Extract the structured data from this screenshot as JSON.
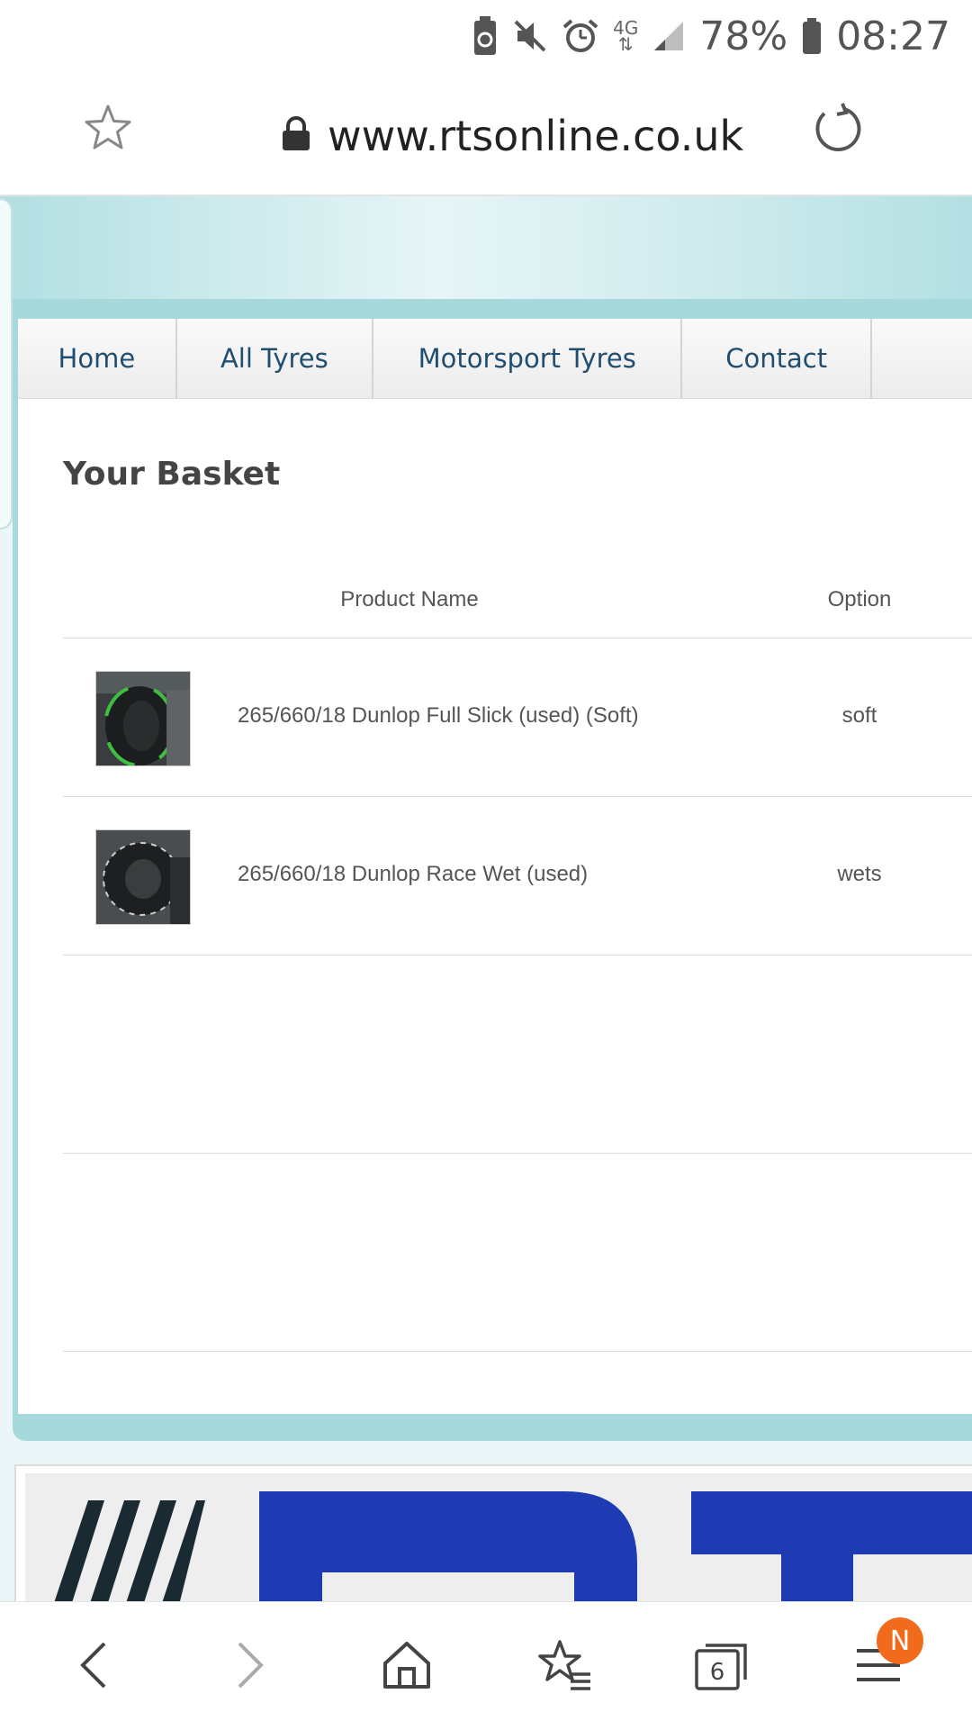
{
  "status_bar": {
    "network": "4G",
    "battery_percent": "78%",
    "time": "08:27",
    "icons": [
      "battery-saver-icon",
      "mute-icon",
      "alarm-icon",
      "network-4g-icon",
      "signal-icon",
      "battery-icon"
    ]
  },
  "address_bar": {
    "url": "www.rtsonline.co.uk",
    "icons": [
      "bookmark-star-icon",
      "lock-icon",
      "reload-icon"
    ]
  },
  "nav": {
    "items": [
      {
        "label": "Home"
      },
      {
        "label": "All Tyres"
      },
      {
        "label": "Motorsport Tyres"
      },
      {
        "label": "Contact"
      },
      {
        "label": ""
      }
    ]
  },
  "basket": {
    "title": "Your Basket",
    "columns": [
      "Product Name",
      "Option"
    ],
    "rows": [
      {
        "name": "265/660/18 Dunlop Full Slick (used) (Soft)",
        "option": "soft",
        "thumb": "slick-tyre-image"
      },
      {
        "name": "265/660/18 Dunlop Race Wet (used)",
        "option": "wets",
        "thumb": "wet-tyre-image"
      }
    ]
  },
  "banner": {
    "image": "rts-logo-banner-image"
  },
  "bottom_nav": {
    "tab_count": "6",
    "badge": "N",
    "icons": [
      "back-icon",
      "forward-icon",
      "home-icon",
      "bookmarks-icon",
      "tabs-icon",
      "menu-icon"
    ]
  },
  "colors": {
    "nav_text": "#1f4e71",
    "teal": "#a7d9dc",
    "badge": "#f26a1b"
  }
}
